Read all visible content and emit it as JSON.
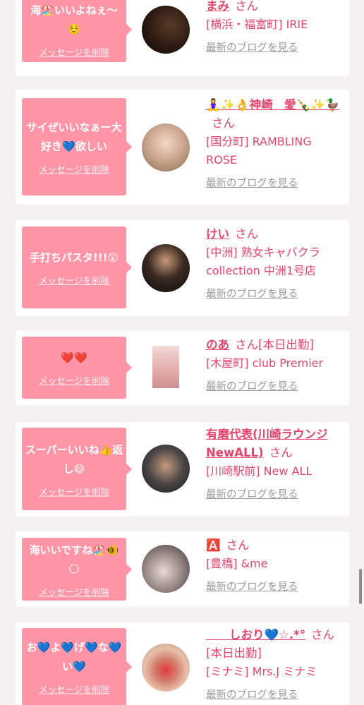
{
  "delete_label": "メッセージを削除",
  "blog_label": "最新のブログを見る",
  "san_label": "さん",
  "colors": {
    "bubble": "#ff95a6",
    "accent": "#e8436b",
    "link_gray": "#9a9a9a",
    "background": "#f4f1f1"
  },
  "messages": [
    {
      "message": "海🏖️いいよねぇ〜☺️",
      "name": "まみ",
      "san": "さん",
      "shop": "[横浜・福富町] IRIE",
      "avatar_icon": "long-dark-hair-photo"
    },
    {
      "message": "サイぜいいなぁー大好き💙欲しい",
      "name": "🧘‍♀️✨👌神崎　愛🍾✨🦆",
      "san": "さん",
      "shop": "[国分町] RAMBLING ROSE",
      "avatar_icon": "blonde-woman-photo"
    },
    {
      "message": "手打ちパスタ!!!😲",
      "name": "けい",
      "san": "さん",
      "shop": "[中洲] 熟女キャバクラ collection 中洲1号店",
      "avatar_icon": "woman-at-bar-photo"
    },
    {
      "message": "❤️❤️",
      "name": "のあ",
      "san": "さん[本日出勤]",
      "shop": "[木屋町] club Premier",
      "avatar_icon": "pink-hair-photo"
    },
    {
      "message": "スーパーいいね👍返し😄",
      "name": "有磨代表(川崎ラウンジNewALL)",
      "san": "さん",
      "shop": "[川崎駅前] New ALL",
      "avatar_icon": "man-with-beard-photo"
    },
    {
      "message": "海いいですね🏖️🐠🌕",
      "name": "🅰️",
      "san": "さん",
      "shop": "[豊橋] &me",
      "avatar_icon": "and-me-logo-photo"
    },
    {
      "message": "お💙よ💙げ💙な💙い💙",
      "name": "　　しおり💙☆.*°",
      "san": "さん[本日出勤]",
      "shop": "[ミナミ] Mrs.J ミナミ",
      "avatar_icon": "heart-covered-face-photo"
    }
  ]
}
